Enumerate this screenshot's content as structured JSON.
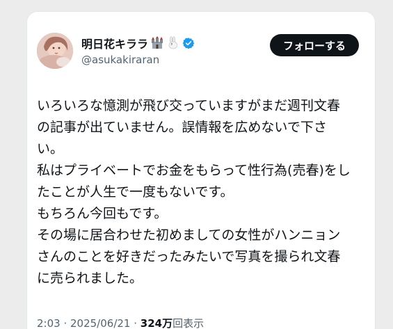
{
  "tweet": {
    "author": {
      "display_name": "明日花キララ",
      "name_emoji": [
        "castle",
        "rabbit"
      ],
      "verified": true,
      "handle": "@asukakiraran"
    },
    "follow_label": "フォローする",
    "lines": [
      "いろいろな憶測が飛び交っていますがまだ週刊文春",
      "の記事が出ていません。誤情報を広めないで下さ",
      "い。",
      "私はプライベートでお金をもらって性行為(売春)をし",
      "たことが人生で一度もないです。",
      "もちろん今回もです。",
      "その場に居合わせた初めましての女性がハンニョン",
      "さんのことを好きだったみたいで写真を撮られ文春",
      "に売られました。"
    ],
    "meta": {
      "time": "2:03",
      "separator1": " · ",
      "date": "2025/06/21",
      "separator2": " · ",
      "views": "324万",
      "views_label": "回表示"
    }
  },
  "colors": {
    "text": "#0f1419",
    "muted": "#536471",
    "verified": "#1d9bf0",
    "button_bg": "#0f1419"
  }
}
